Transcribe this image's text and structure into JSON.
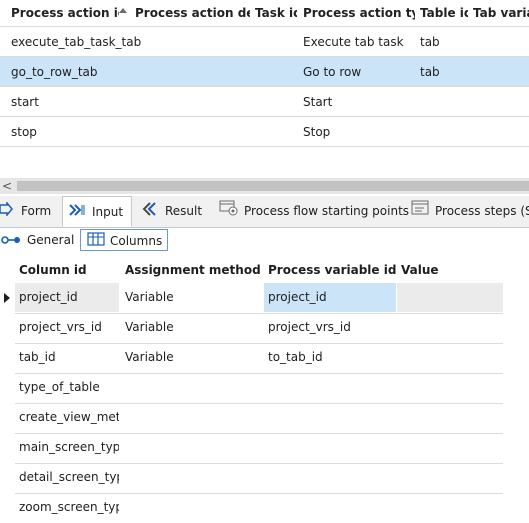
{
  "top_grid": {
    "columns": [
      "Process action id",
      "Process action desc.",
      "Task id",
      "Process action type",
      "Table id",
      "Tab variant"
    ],
    "rows": [
      {
        "id": "execute_tab_task_tab",
        "desc": "",
        "task": "",
        "type": "Execute tab task",
        "table": "tab",
        "variant": ""
      },
      {
        "id": "go_to_row_tab",
        "desc": "",
        "task": "",
        "type": "Go to row",
        "table": "tab",
        "variant": ""
      },
      {
        "id": "start",
        "desc": "",
        "task": "",
        "type": "Start",
        "table": "",
        "variant": ""
      },
      {
        "id": "stop",
        "desc": "",
        "task": "",
        "type": "Stop",
        "table": "",
        "variant": ""
      }
    ],
    "selected_row": 1
  },
  "scrollbar": {
    "left_arrow": "<"
  },
  "tabs": [
    {
      "label": "Form",
      "icon": "form-icon"
    },
    {
      "label": "Input",
      "icon": "input-arrow-icon",
      "active": true
    },
    {
      "label": "Result",
      "icon": "result-icon"
    },
    {
      "label": "Process flow starting points",
      "icon": "process-flow-icon"
    },
    {
      "label": "Process steps (Su",
      "icon": "process-steps-icon"
    }
  ],
  "subtabs": [
    {
      "label": "General",
      "icon": "general-icon"
    },
    {
      "label": "Columns",
      "icon": "columns-icon",
      "active": true
    }
  ],
  "bottom_grid": {
    "columns": [
      "Column id",
      "Assignment method",
      "Process variable id",
      "Value"
    ],
    "rows": [
      {
        "col": "project_id",
        "method": "Variable",
        "var": "project_id",
        "value": ""
      },
      {
        "col": "project_vrs_id",
        "method": "Variable",
        "var": "project_vrs_id",
        "value": ""
      },
      {
        "col": "tab_id",
        "method": "Variable",
        "var": "to_tab_id",
        "value": ""
      },
      {
        "col": "type_of_table",
        "method": "",
        "var": "",
        "value": ""
      },
      {
        "col": "create_view_meth",
        "method": "",
        "var": "",
        "value": ""
      },
      {
        "col": "main_screen_type",
        "method": "",
        "var": "",
        "value": ""
      },
      {
        "col": "detail_screen_typ",
        "method": "",
        "var": "",
        "value": ""
      },
      {
        "col": "zoom_screen_typ",
        "method": "",
        "var": "",
        "value": ""
      }
    ]
  },
  "colors": {
    "selection": "#cce4f7",
    "accent": "#1a5fb4"
  }
}
